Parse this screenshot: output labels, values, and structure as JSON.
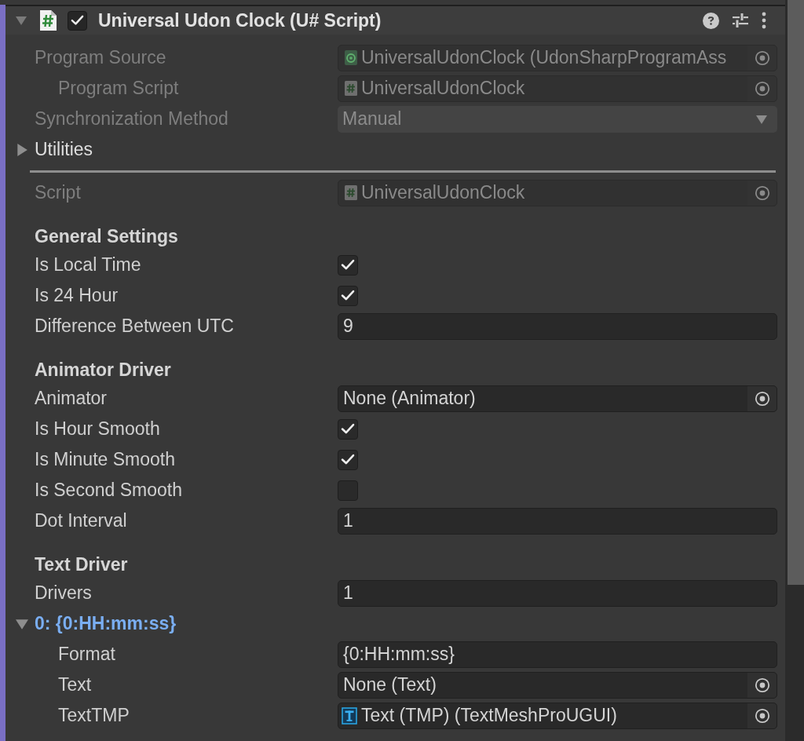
{
  "component": {
    "title": "Universal Udon Clock (U# Script)",
    "expanded": true,
    "enabled": true
  },
  "properties": [
    {
      "kind": "program",
      "label": "Program Source",
      "value": "UniversalUdonClock (UdonSharpProgramAss",
      "disabled": true,
      "modified": false,
      "children": [
        {
          "kind": "script",
          "label": "Program Script",
          "value": "UniversalUdonClock",
          "disabled": true,
          "modified": false
        }
      ]
    },
    {
      "kind": "dropdown",
      "label": "Synchronization Method",
      "value": "Manual",
      "disabled": true,
      "modified": false
    },
    {
      "kind": "foldout",
      "label": "Utilities",
      "expanded": false,
      "disabled": false,
      "modified": false
    },
    {
      "kind": "separator"
    },
    {
      "kind": "script",
      "label": "Script",
      "value": "UniversalUdonClock",
      "disabled": true,
      "modified": false
    },
    {
      "kind": "header",
      "label": "General Settings"
    },
    {
      "kind": "toggle",
      "label": "Is Local Time",
      "checked": true,
      "disabled": false,
      "modified": false
    },
    {
      "kind": "toggle",
      "label": "Is 24 Hour",
      "checked": true,
      "disabled": false,
      "modified": false
    },
    {
      "kind": "text",
      "label": "Difference Between UTC",
      "value": "9",
      "disabled": false,
      "modified": false
    },
    {
      "kind": "header",
      "label": "Animator Driver"
    },
    {
      "kind": "object",
      "label": "Animator",
      "value": "None (Animator)",
      "disabled": false,
      "modified": false
    },
    {
      "kind": "toggle",
      "label": "Is Hour Smooth",
      "checked": true,
      "disabled": false,
      "modified": false
    },
    {
      "kind": "toggle",
      "label": "Is Minute Smooth",
      "checked": true,
      "disabled": false,
      "modified": false
    },
    {
      "kind": "toggle",
      "label": "Is Second Smooth",
      "checked": false,
      "disabled": false,
      "modified": false
    },
    {
      "kind": "text",
      "label": "Dot Interval",
      "value": "1",
      "disabled": false,
      "modified": false
    },
    {
      "kind": "header",
      "label": "Text Driver"
    },
    {
      "kind": "text",
      "label": "Drivers",
      "value": "1",
      "disabled": false,
      "modified": false
    },
    {
      "kind": "foldout",
      "label": "0: {0:HH:mm:ss}",
      "expanded": true,
      "disabled": false,
      "modified": true,
      "children": [
        {
          "kind": "text",
          "label": "Format",
          "value": "{0:HH:mm:ss}",
          "disabled": false,
          "modified": false
        },
        {
          "kind": "object",
          "label": "Text",
          "value": "None (Text)",
          "disabled": false,
          "modified": false
        },
        {
          "kind": "component",
          "label": "TextTMP",
          "value": "Text (TMP) (TextMeshProUGUI)",
          "disabled": false,
          "modified": false
        }
      ]
    }
  ]
}
